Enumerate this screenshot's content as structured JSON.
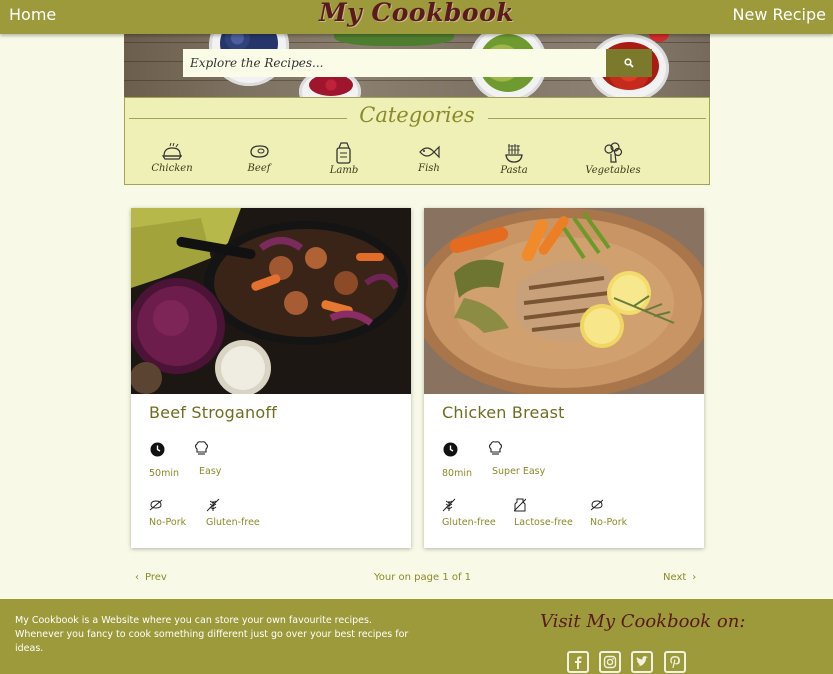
{
  "nav": {
    "home_label": "Home",
    "brand": "My Cookbook",
    "new_recipe_label": "New Recipe"
  },
  "search": {
    "placeholder": "Explore the Recipes..."
  },
  "categories": {
    "title": "Categories",
    "items": [
      {
        "label": "Chicken",
        "icon": "chicken-icon"
      },
      {
        "label": "Beef",
        "icon": "beef-icon"
      },
      {
        "label": "Lamb",
        "icon": "lamb-icon"
      },
      {
        "label": "Fish",
        "icon": "fish-icon"
      },
      {
        "label": "Pasta",
        "icon": "pasta-icon"
      },
      {
        "label": "Vegetables",
        "icon": "vegetables-icon"
      }
    ]
  },
  "recipes": [
    {
      "title": "Beef Stroganoff",
      "time": "50min",
      "difficulty": "Easy",
      "tags": [
        "No-Pork",
        "Gluten-free"
      ]
    },
    {
      "title": "Chicken Breast",
      "time": "80min",
      "difficulty": "Super Easy",
      "tags": [
        "Gluten-free",
        "Lactose-free",
        "No-Pork"
      ]
    }
  ],
  "pagination": {
    "prev_label": "Prev",
    "status": "Your on page 1 of 1",
    "next_label": "Next"
  },
  "footer": {
    "description": "My Cookbook is a Website where you can store your own favourite recipes. Whenever you fancy to cook something different just go over your best recipes for ideas.",
    "visit_label": "Visit My Cookbook on:",
    "social": [
      "facebook-icon",
      "instagram-icon",
      "twitter-icon",
      "pinterest-icon"
    ]
  },
  "colors": {
    "olive": "#9c9a3a",
    "brand": "#5b1a1e",
    "category_bg": "#eff0b6",
    "page_bg": "#f8f9e6",
    "text_olive": "#8a8a2a"
  }
}
